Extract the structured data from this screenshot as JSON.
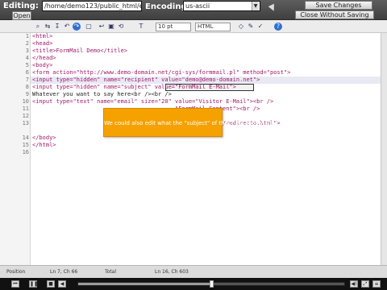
{
  "topbar": {
    "editing_label": "Editing:",
    "file_path": "/home/demo123/public_html/emailfor",
    "open_button": "Open",
    "encoding_label": "Encoding :",
    "encoding_value": "us-ascii",
    "save_button": "Save Changes",
    "close_button": "Close Without Saving"
  },
  "toolbar": {
    "font_size_value": "10 pt",
    "syntax_value": "HTML"
  },
  "editor": {
    "line_numbers": [
      "1",
      "2",
      "3",
      "4",
      "5",
      "6",
      "7",
      "8",
      "9",
      "10",
      "11",
      "12",
      "13",
      "14",
      "15",
      "16"
    ],
    "lines": [
      {
        "text": "<html>"
      },
      {
        "text": "<head>"
      },
      {
        "text": "<title>FormMail Demo</title>"
      },
      {
        "text": "</head>"
      },
      {
        "text": "<body>"
      },
      {
        "text": "<form action=\"http://www.demo-domain.net/cgi-sys/formmail.pl\" method=\"post\">"
      },
      {
        "text": "<input type=\"hidden\" name=\"recipient\" value=\"demo@demo-domain.net\">"
      },
      {
        "text": "<input type=\"hidden\" name=\"subject\" value=\"FormMail E-Mail\">"
      },
      {
        "text": "Whatever you want to say here<br /><br />"
      },
      {
        "text": "<input type=\"text\" name=\"email\" size=\"20\" value=\"Visitor E-Mail\"><br />"
      },
      {
        "text": "                                          \"FormMail Content\"><br />"
      },
      {
        "text": "                                        ><br />"
      },
      {
        "text": "                                          yourdomain.com/redirecto.html\">"
      },
      {
        "text": "</body>"
      },
      {
        "text": "</html>"
      },
      {
        "text": ""
      }
    ]
  },
  "callout": {
    "text": "We could also edit what the \"subject\" of the messages will be"
  },
  "statusbar": {
    "position_label": "Position",
    "position_value": "Ln 7, Ch 66",
    "total_label": "Total",
    "total_value": "Ln 16, Ch 603"
  },
  "player": {
    "progress": 0.5
  }
}
